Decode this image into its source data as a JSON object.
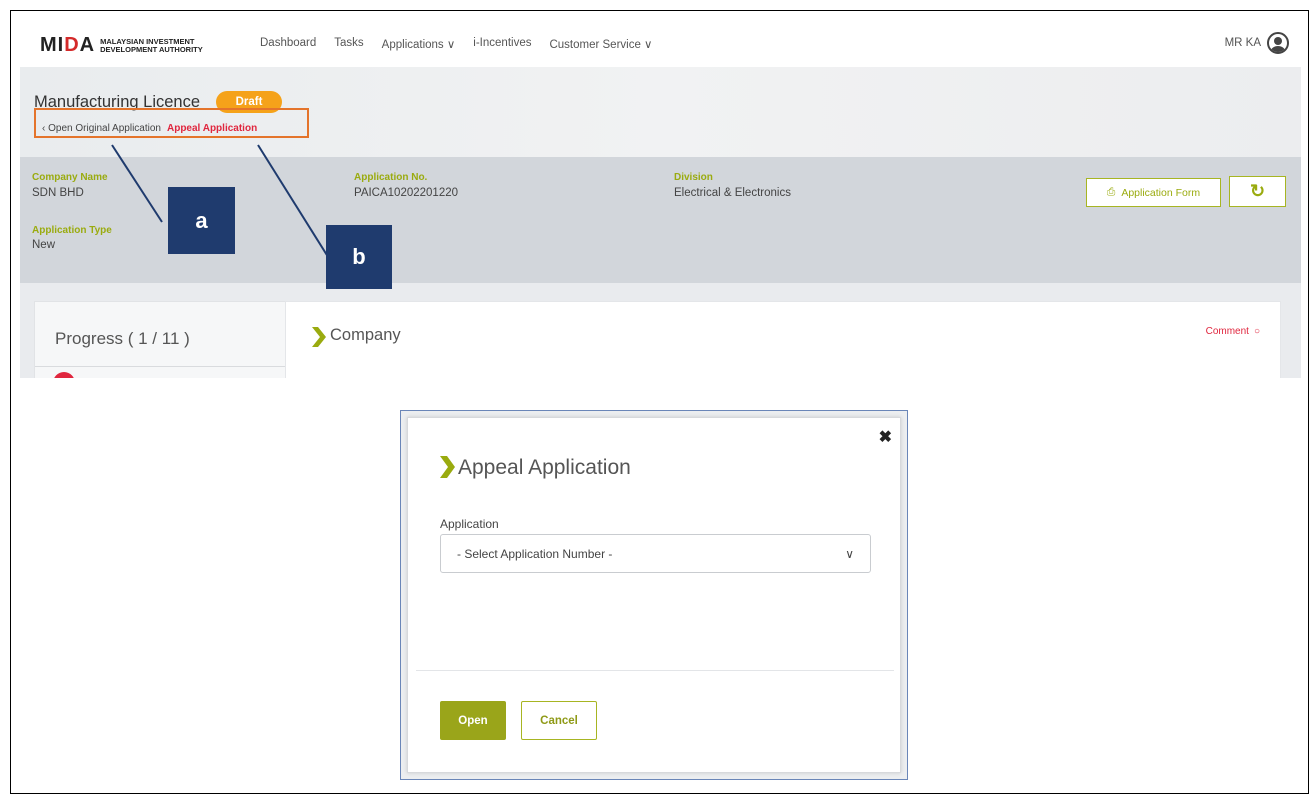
{
  "nav": {
    "logo_mark": "MIDA",
    "logo_line1": "MALAYSIAN INVESTMENT",
    "logo_line2": "DEVELOPMENT AUTHORITY",
    "links": [
      "Dashboard",
      "Tasks",
      "Applications ∨",
      "i-Incentives",
      "Customer Service ∨"
    ],
    "user_name": "MR KA",
    "avatar_icon": "user-avatar-icon"
  },
  "header": {
    "title": "Manufacturing Licence",
    "status_badge": "Draft",
    "back_link": "Open Original Application",
    "appeal_link": "Appeal Application"
  },
  "info": {
    "company_name_label": "Company Name",
    "company_name": "SDN BHD",
    "application_no_label": "Application No.",
    "application_no": "PAICA10202201220",
    "division_label": "Division",
    "division": "Electrical & Electronics",
    "application_type_label": "Application Type",
    "application_type": "New",
    "app_form_button": "Application Form",
    "history_icon": "history-icon"
  },
  "progress": {
    "title": "Progress ( 1 / 11 )"
  },
  "section": {
    "title": "Company",
    "comment_link": "Comment"
  },
  "callouts": {
    "a": "a",
    "b": "b"
  },
  "modal": {
    "title": "Appeal Application",
    "field_label": "Application",
    "select_placeholder": "- Select Application Number -",
    "open_button": "Open",
    "cancel_button": "Cancel"
  },
  "colors": {
    "accent_olive": "#9aab0f",
    "draft_orange": "#f5a21a",
    "link_red": "#e0263e",
    "highlight_orange": "#e4742b",
    "callout_navy": "#1f3b6e",
    "info_bar_gray": "#d2d6db"
  }
}
